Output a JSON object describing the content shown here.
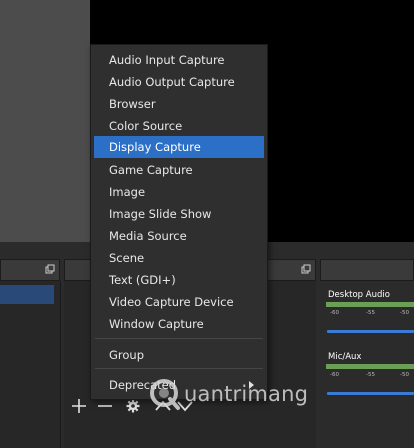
{
  "context_menu": {
    "items": [
      {
        "label": "Audio Input Capture"
      },
      {
        "label": "Audio Output Capture"
      },
      {
        "label": "Browser"
      },
      {
        "label": "Color Source"
      },
      {
        "label": "Display Capture",
        "selected": true
      },
      {
        "label": "Game Capture"
      },
      {
        "label": "Image"
      },
      {
        "label": "Image Slide Show"
      },
      {
        "label": "Media Source"
      },
      {
        "label": "Scene"
      },
      {
        "label": "Text (GDI+)"
      },
      {
        "label": "Video Capture Device"
      },
      {
        "label": "Window Capture"
      }
    ],
    "group_label": "Group",
    "deprecated_label": "Deprecated",
    "selected_color": "#2b6fc7"
  },
  "audio_mixer": {
    "channels": [
      {
        "name": "Desktop Audio",
        "ticks": [
          "-60",
          "-55",
          "-50"
        ]
      },
      {
        "name": "Mic/Aux",
        "ticks": [
          "-60",
          "-55",
          "-50"
        ]
      }
    ],
    "meter_color": "#6b9f56",
    "slider_color": "#3a7bd5"
  },
  "toolbar": {
    "icons": [
      "plus-icon",
      "minus-icon",
      "gear-icon",
      "chevron-up-icon",
      "chevron-down-icon"
    ]
  },
  "watermark": {
    "text": "uantrimang"
  }
}
